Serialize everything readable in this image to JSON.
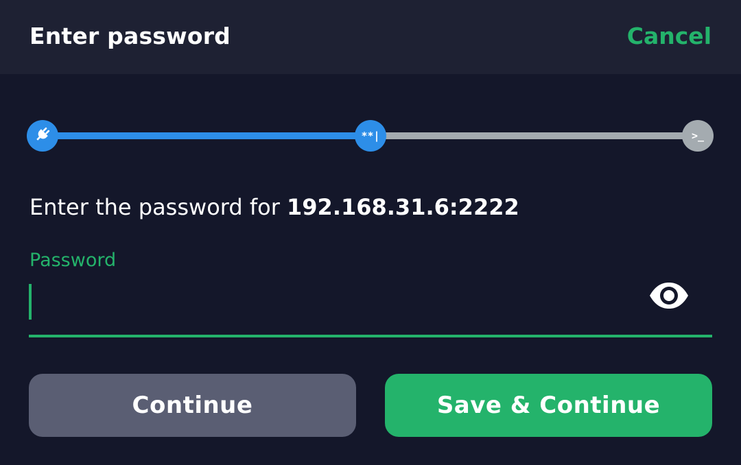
{
  "header": {
    "title": "Enter password",
    "cancel_label": "Cancel"
  },
  "stepper": {
    "steps": [
      {
        "icon": "plug-icon",
        "state": "done"
      },
      {
        "icon": "password-icon",
        "label": "**|",
        "state": "current"
      },
      {
        "icon": "terminal-icon",
        "label": ">_",
        "state": "pending"
      }
    ],
    "colors": {
      "active": "#2d8ee8",
      "inactive": "#a4abb0"
    }
  },
  "prompt": {
    "text": "Enter the password for ",
    "host": "192.168.31.6:2222"
  },
  "password_field": {
    "label": "Password",
    "value": "",
    "visibility_icon": "eye-icon"
  },
  "buttons": {
    "continue_label": "Continue",
    "save_continue_label": "Save & Continue"
  },
  "colors": {
    "accent": "#24b36b",
    "background": "#14172a",
    "header": "#1e2133",
    "secondary_button": "#5a5e73"
  }
}
